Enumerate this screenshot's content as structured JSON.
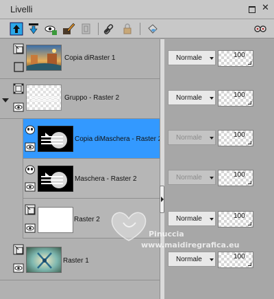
{
  "panel": {
    "title": "Livelli",
    "window_buttons": [
      "restore-icon",
      "close-icon"
    ]
  },
  "toolbar": {
    "tools": [
      "new-raster-layer-icon",
      "new-mask-layer-icon",
      "visibility-eye-icon",
      "paint-brush-icon",
      "duplicate-layer-icon",
      "link-icon",
      "lock-icon",
      "paint-bucket-icon"
    ],
    "right_tool": "view-glasses-icon"
  },
  "layers": [
    {
      "name": "Copia diRaster 1",
      "blend": "Normale",
      "opacity": "100",
      "visible": false,
      "selected": false,
      "kind": "raster"
    },
    {
      "name": "Gruppo - Raster 2",
      "blend": "Normale",
      "opacity": "100",
      "visible": true,
      "selected": false,
      "kind": "group",
      "expanded": true
    },
    {
      "name": "Copia diMaschera - Raster 2",
      "blend": "Normale",
      "opacity": "100",
      "visible": true,
      "selected": true,
      "kind": "mask"
    },
    {
      "name": "Maschera - Raster 2",
      "blend": "Normale",
      "opacity": "100",
      "visible": true,
      "selected": false,
      "kind": "mask"
    },
    {
      "name": "Raster 2",
      "blend": "Normale",
      "opacity": "100",
      "visible": true,
      "selected": false,
      "kind": "raster"
    },
    {
      "name": "Raster 1",
      "blend": "Normale",
      "opacity": "100",
      "visible": true,
      "selected": false,
      "kind": "raster"
    }
  ],
  "watermark": {
    "line1": "Pinuccia",
    "line2": "www.maidiregrafica.eu"
  },
  "colors": {
    "selection": "#3399ff",
    "panel_bg": "#b1b1b1",
    "toolbar_bg": "#c8c8c8"
  }
}
